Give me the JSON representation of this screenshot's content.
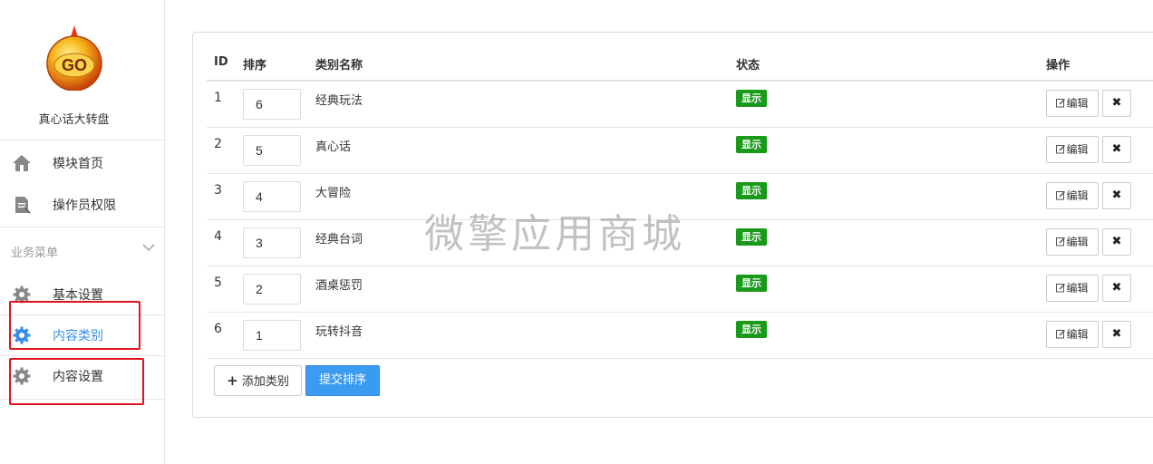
{
  "app": {
    "name": "真心话大转盘",
    "logo_text": "GO"
  },
  "sidebar": {
    "items": [
      {
        "label": "模块首页",
        "icon": "home-icon"
      },
      {
        "label": "操作员权限",
        "icon": "document-icon"
      }
    ],
    "group": {
      "title": "业务菜单",
      "items": [
        {
          "label": "基本设置",
          "icon": "gear-icon"
        },
        {
          "label": "内容类别",
          "icon": "gear-icon",
          "active": true
        },
        {
          "label": "内容设置",
          "icon": "gear-icon"
        }
      ]
    }
  },
  "table": {
    "headers": {
      "id": "ID",
      "sort": "排序",
      "name": "类别名称",
      "status": "状态",
      "action": "操作"
    },
    "rows": [
      {
        "id": "1",
        "sort": "6",
        "name": "经典玩法",
        "status": "显示"
      },
      {
        "id": "2",
        "sort": "5",
        "name": "真心话",
        "status": "显示"
      },
      {
        "id": "3",
        "sort": "4",
        "name": "大冒险",
        "status": "显示"
      },
      {
        "id": "4",
        "sort": "3",
        "name": "经典台词",
        "status": "显示"
      },
      {
        "id": "5",
        "sort": "2",
        "name": "酒桌惩罚",
        "status": "显示"
      },
      {
        "id": "6",
        "sort": "1",
        "name": "玩转抖音",
        "status": "显示"
      }
    ],
    "edit_label": "编辑",
    "delete_label": "✖"
  },
  "buttons": {
    "add": "添加类别",
    "submit": "提交排序"
  },
  "watermark": "微擎应用商城",
  "colors": {
    "accent": "#3b9bf0",
    "badge": "#1a9a1a",
    "highlight": "#e0141e"
  }
}
